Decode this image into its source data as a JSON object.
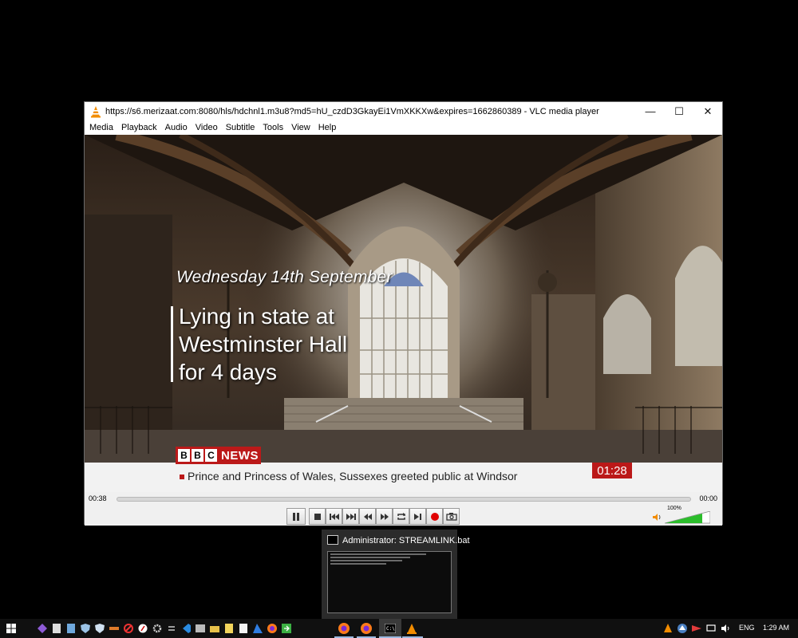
{
  "window": {
    "title": "https://s6.merizaat.com:8080/hls/hdchnl1.m3u8?md5=hU_czdD3GkayEi1VmXKKXw&expires=1662860389 - VLC media player",
    "minimize_glyph": "—",
    "maximize_glyph": "☐",
    "close_glyph": "✕"
  },
  "menu": [
    "Media",
    "Playback",
    "Audio",
    "Video",
    "Subtitle",
    "Tools",
    "View",
    "Help"
  ],
  "video": {
    "date_line": "Wednesday 14th September",
    "headline_lines": [
      "Lying in state at",
      "Westminster Hall",
      "for 4 days"
    ],
    "channel_letters": [
      "B",
      "B",
      "C"
    ],
    "channel_word": "NEWS",
    "ticker": "Prince and Princess of Wales, Sussexes greeted public at Windsor",
    "clock": "01:28"
  },
  "player": {
    "elapsed": "00:38",
    "remaining": "00:00",
    "volume_pct": "100%",
    "volume_level": 1.0,
    "buttons": [
      "pause-icon",
      "stop-icon",
      "prev-icon",
      "next-icon",
      "slower-icon",
      "faster-icon",
      "loop-icon",
      "frame-step-icon",
      "record-icon",
      "snapshot-icon"
    ]
  },
  "thumbnail": {
    "title": "Administrator:  STREAMLINK.bat"
  },
  "taskbar": {
    "language": "ENG",
    "time": "1:29 AM"
  },
  "colors": {
    "bbc_red": "#bb1919",
    "vlc_orange": "#f28c00",
    "volume_green": "#2bbd2b"
  }
}
